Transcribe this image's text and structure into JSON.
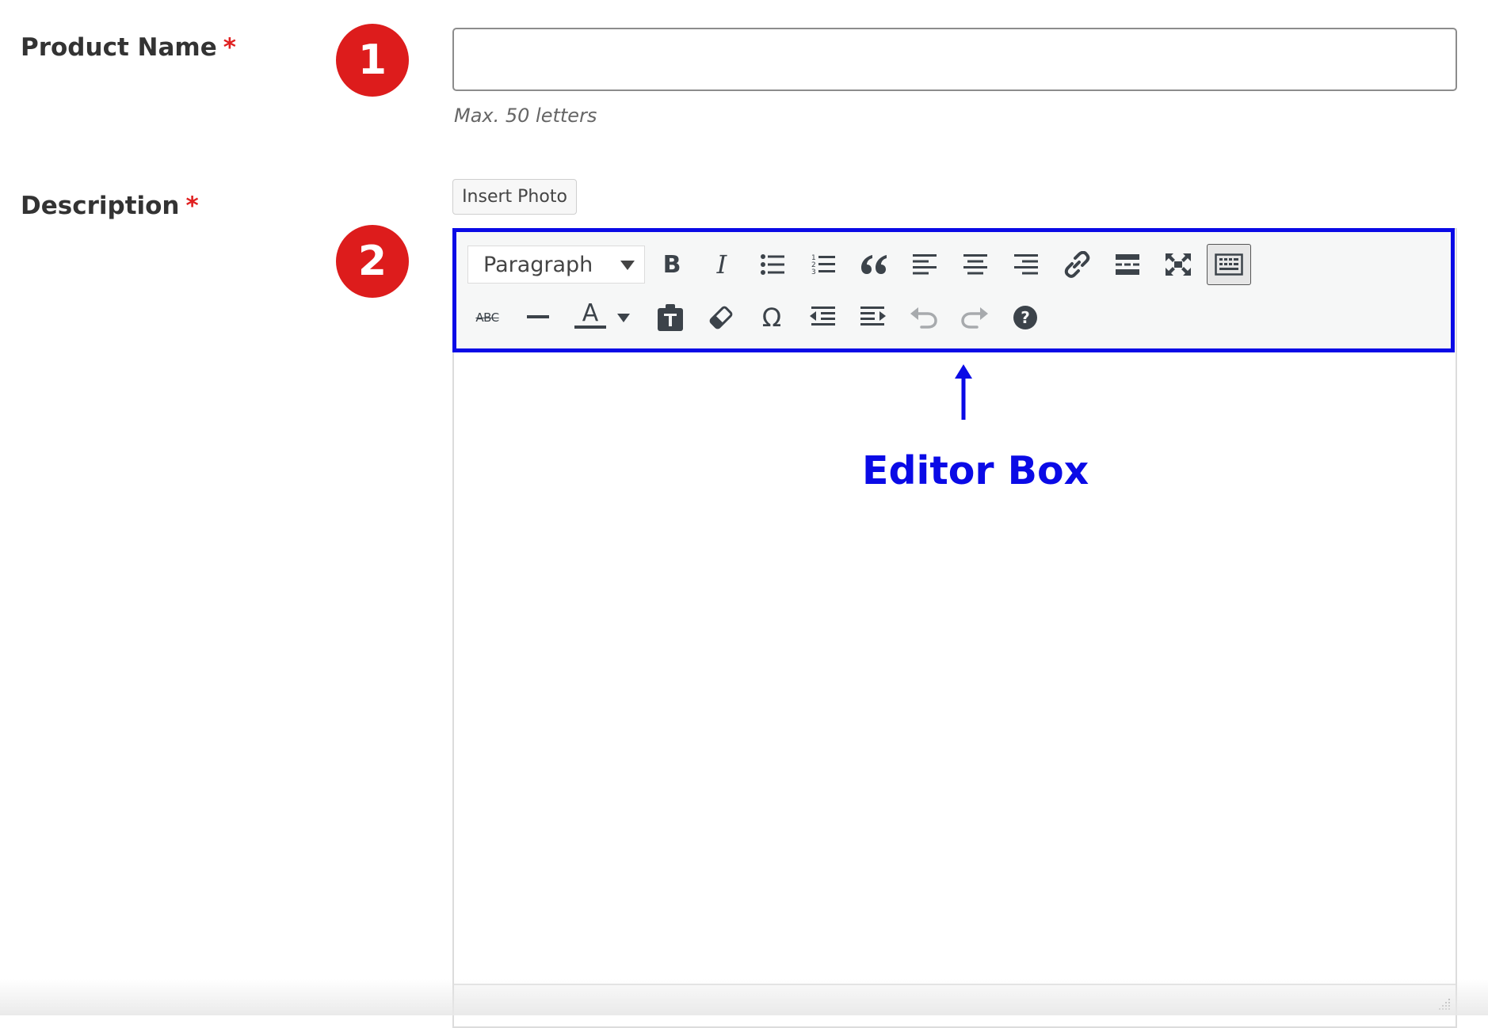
{
  "form": {
    "product_name": {
      "label": "Product Name",
      "required_mark": "*",
      "step": "1",
      "value": "",
      "hint": "Max. 50 letters"
    },
    "description": {
      "label": "Description",
      "required_mark": "*",
      "step": "2",
      "insert_photo_label": "Insert Photo"
    }
  },
  "toolbar": {
    "format_select_value": "Paragraph",
    "row1": [
      "bold-icon",
      "italic-icon",
      "bulleted-list-icon",
      "numbered-list-icon",
      "blockquote-icon",
      "align-left-icon",
      "align-center-icon",
      "align-right-icon",
      "link-icon",
      "read-more-icon",
      "fullscreen-icon",
      "toolbar-toggle-icon"
    ],
    "row2": [
      "strikethrough-icon",
      "horizontal-line-icon",
      "text-color-icon",
      "paste-as-text-icon",
      "clear-formatting-icon",
      "special-character-icon",
      "outdent-icon",
      "indent-icon",
      "undo-icon",
      "redo-icon",
      "help-icon"
    ],
    "active_button": "toolbar-toggle-icon",
    "strikethrough_glyph": "ABC",
    "text_color_glyph": "A",
    "special_char_glyph": "Ω",
    "bold_glyph": "B",
    "italic_glyph": "I"
  },
  "annotation": {
    "callout_text": "Editor Box",
    "accent_color": "#0a0ae6",
    "badge_color": "#dd1c1c"
  }
}
